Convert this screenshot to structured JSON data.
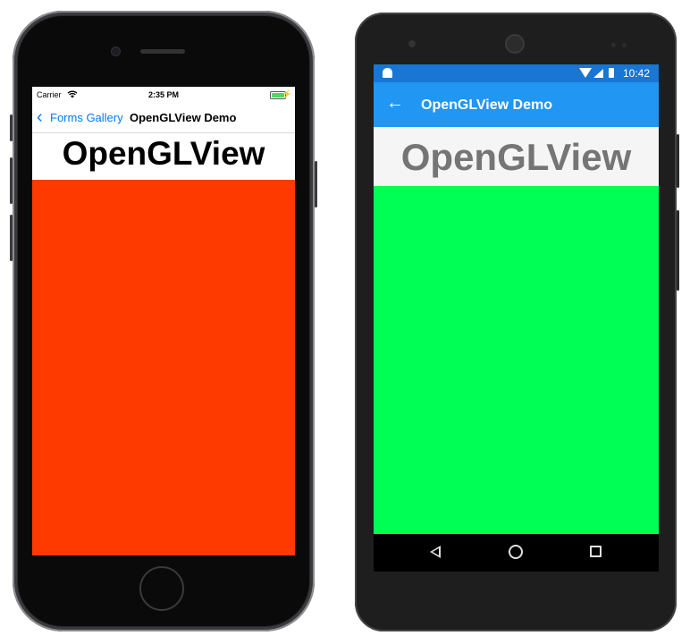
{
  "ios": {
    "status": {
      "carrier": "Carrier",
      "time": "2:35 PM",
      "charging_symbol": "⚡"
    },
    "nav": {
      "back_symbol": "‹",
      "back_label": "Forms Gallery",
      "title": "OpenGLView Demo"
    },
    "heading": "OpenGLView",
    "gl_color": "#ff3a00",
    "accent": "#007aff"
  },
  "android": {
    "status": {
      "time": "10:42"
    },
    "toolbar": {
      "back_symbol": "←",
      "title": "OpenGLView Demo"
    },
    "heading": "OpenGLView",
    "gl_color": "#00ff55",
    "primary": "#2196f3",
    "primary_dark": "#1976d2",
    "nav_icons": [
      "back-icon",
      "home-icon",
      "recent-apps-icon"
    ]
  }
}
